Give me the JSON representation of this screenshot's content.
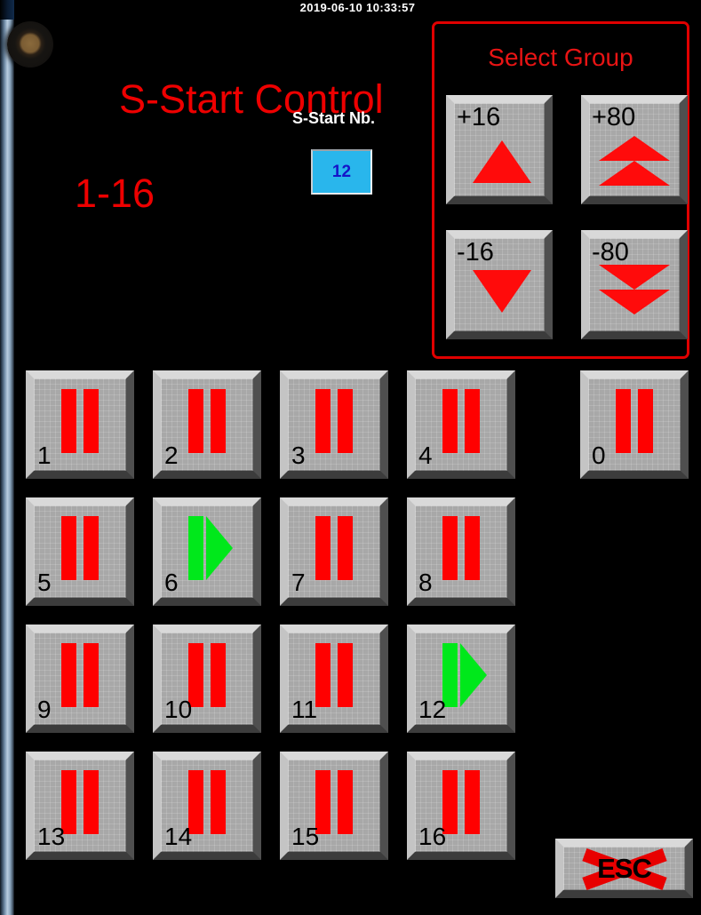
{
  "device": {
    "lens_icon": "camera-lens-icon",
    "bezel": "left-bezel-strip"
  },
  "screen": {
    "clock": "2019-06-10 10:33:57",
    "title_line1": "S-Start Control",
    "title_line2": "1-16",
    "title_color": "#ee0000",
    "background_color": "#000000"
  },
  "sstart_nb": {
    "label": "S-Start Nb.",
    "value": "12",
    "value_color": "#1414c8",
    "field_color": "#29b6ec"
  },
  "select_group": {
    "title": "Select Group",
    "border_color": "#e00000",
    "buttons": [
      {
        "label": "+16",
        "icon": "triangle-up-icon",
        "direction": "up",
        "step": 16
      },
      {
        "label": "+80",
        "icon": "double-triangle-up-icon",
        "direction": "up",
        "step": 80
      },
      {
        "label": "-16",
        "icon": "triangle-down-icon",
        "direction": "down",
        "step": 16
      },
      {
        "label": "-80",
        "icon": "double-triangle-down-icon",
        "direction": "down",
        "step": 80
      }
    ]
  },
  "grid": {
    "stopped_color": "#ff0000",
    "running_color": "#00e81b",
    "cells": [
      {
        "number": "1",
        "state": "stopped",
        "icon": "pause-icon"
      },
      {
        "number": "2",
        "state": "stopped",
        "icon": "pause-icon"
      },
      {
        "number": "3",
        "state": "stopped",
        "icon": "pause-icon"
      },
      {
        "number": "4",
        "state": "stopped",
        "icon": "pause-icon"
      },
      {
        "number": "0",
        "state": "stopped",
        "icon": "pause-icon"
      },
      {
        "number": "5",
        "state": "stopped",
        "icon": "pause-icon"
      },
      {
        "number": "6",
        "state": "running",
        "icon": "play-icon"
      },
      {
        "number": "7",
        "state": "stopped",
        "icon": "pause-icon"
      },
      {
        "number": "8",
        "state": "stopped",
        "icon": "pause-icon"
      },
      {
        "number": "9",
        "state": "stopped",
        "icon": "pause-icon"
      },
      {
        "number": "10",
        "state": "stopped",
        "icon": "pause-icon"
      },
      {
        "number": "11",
        "state": "stopped",
        "icon": "pause-icon"
      },
      {
        "number": "12",
        "state": "running",
        "icon": "play-icon"
      },
      {
        "number": "13",
        "state": "stopped",
        "icon": "pause-icon"
      },
      {
        "number": "14",
        "state": "stopped",
        "icon": "pause-icon"
      },
      {
        "number": "15",
        "state": "stopped",
        "icon": "pause-icon"
      },
      {
        "number": "16",
        "state": "stopped",
        "icon": "pause-icon"
      }
    ]
  },
  "esc": {
    "label": "ESC",
    "icon": "red-cross-icon",
    "cross_color": "#e80000"
  }
}
